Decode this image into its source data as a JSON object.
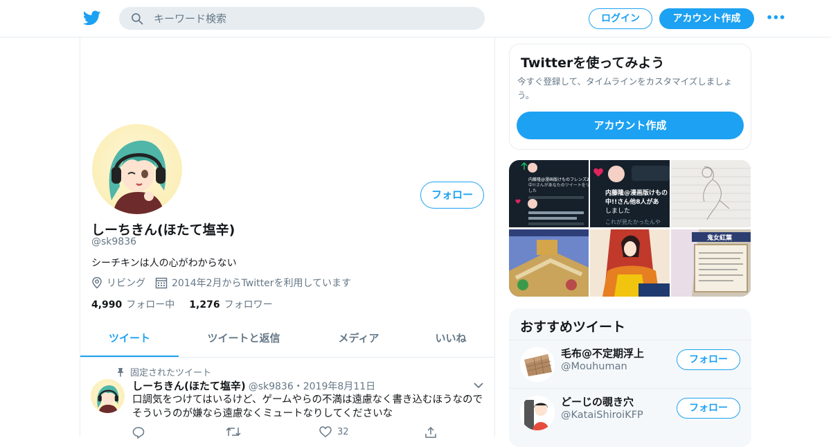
{
  "header": {
    "search_placeholder": "キーワード検索",
    "login_label": "ログイン",
    "signup_label": "アカウント作成",
    "more_label": "•••"
  },
  "profile": {
    "name": "しーちきん(ほたて塩辛)",
    "handle": "@sk9836",
    "bio": "シーチキンは人の心がわからない",
    "location": "リビング",
    "joined": "2014年2月からTwitterを利用しています",
    "follow_label": "フォロー",
    "following_count": "4,990",
    "following_label": "フォロー中",
    "followers_count": "1,276",
    "followers_label": "フォロワー"
  },
  "tabs": [
    {
      "label": "ツイート",
      "active": true
    },
    {
      "label": "ツイートと返信",
      "active": false
    },
    {
      "label": "メディア",
      "active": false
    },
    {
      "label": "いいね",
      "active": false
    }
  ],
  "pinned_tweet": {
    "pinned_label": "固定されたツイート",
    "author": "しーちきん(ほたて塩辛)",
    "handle": "@sk9836",
    "separator": "・",
    "date": "2019年8月11日",
    "text": "口調気をつけてはいるけど、ゲームやらの不満は遠慮なく書き込むほうなのでそういうのが嫌なら遠慮なくミュートなりしてくださいな",
    "like_count": "32"
  },
  "sidebar": {
    "try_title": "Twitterを使ってみよう",
    "try_desc": "今すぐ登録して、タイムラインをカスタマイズしましょう。",
    "try_button": "アカウント作成",
    "media_tiles": [
      {
        "lines": [
          "内藤隆@漫画版けものフレンズ2 第2",
          "中!!さんがあなたのツイートをリツイ",
          "した"
        ]
      },
      {
        "lines": [
          "内藤隆@漫画版けもの",
          "中!!さん他8人があ",
          "しました",
          "これが見たかったんや"
        ]
      },
      {
        "lines": []
      },
      {
        "lines": []
      },
      {
        "lines": []
      },
      {
        "lines": [
          "鬼女紅葉"
        ]
      }
    ],
    "rec_title": "おすすめツイート",
    "recommendations": [
      {
        "name": "毛布@不定期浮上",
        "handle": "@Mouhuman",
        "follow_label": "フォロー"
      },
      {
        "name": "どーじの覗き穴",
        "handle": "@KataiShiroiKFP",
        "follow_label": "フォロー"
      }
    ]
  },
  "colors": {
    "accent": "#1da1f2",
    "muted_text": "#657786",
    "border": "#e6ecf0"
  }
}
